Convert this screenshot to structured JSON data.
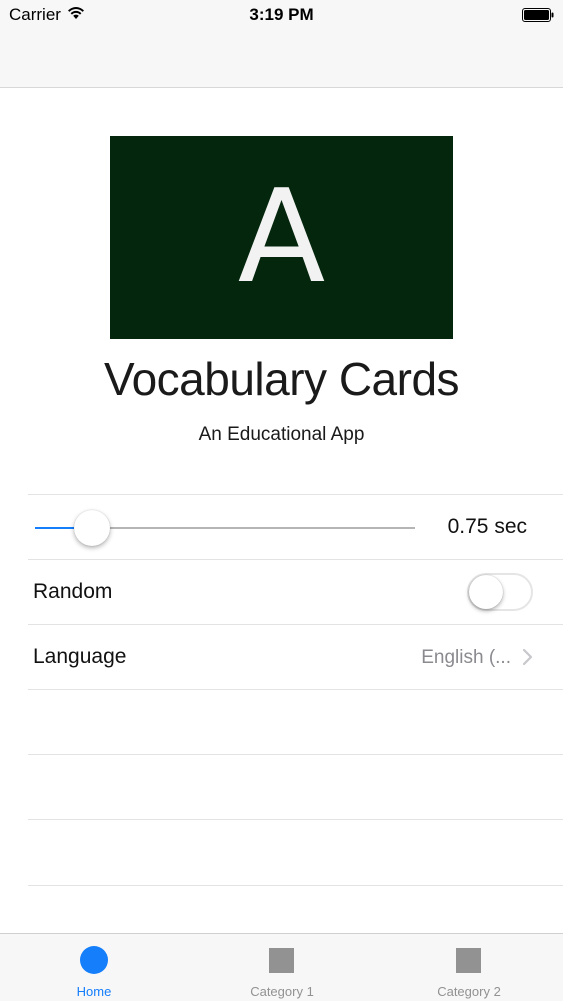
{
  "status_bar": {
    "carrier": "Carrier",
    "time": "3:19 PM",
    "wifi_icon": "wifi-icon",
    "battery_icon": "battery-full-icon"
  },
  "header": {
    "logo_letter": "A",
    "logo_color": "#03260c",
    "title": "Vocabulary Cards",
    "subtitle": "An Educational App"
  },
  "settings": {
    "slider": {
      "value_label": "0.75 sec",
      "fill_fraction": 0.15
    },
    "random": {
      "label": "Random",
      "on": false
    },
    "language": {
      "label": "Language",
      "value": "English (...",
      "icon": "chevron-right-icon"
    }
  },
  "tab_bar": {
    "accent_color": "#147efb",
    "inactive_color": "#929292",
    "tabs": [
      {
        "label": "Home",
        "icon": "circle-icon",
        "active": true
      },
      {
        "label": "Category 1",
        "icon": "square-icon",
        "active": false
      },
      {
        "label": "Category 2",
        "icon": "square-icon",
        "active": false
      }
    ]
  }
}
